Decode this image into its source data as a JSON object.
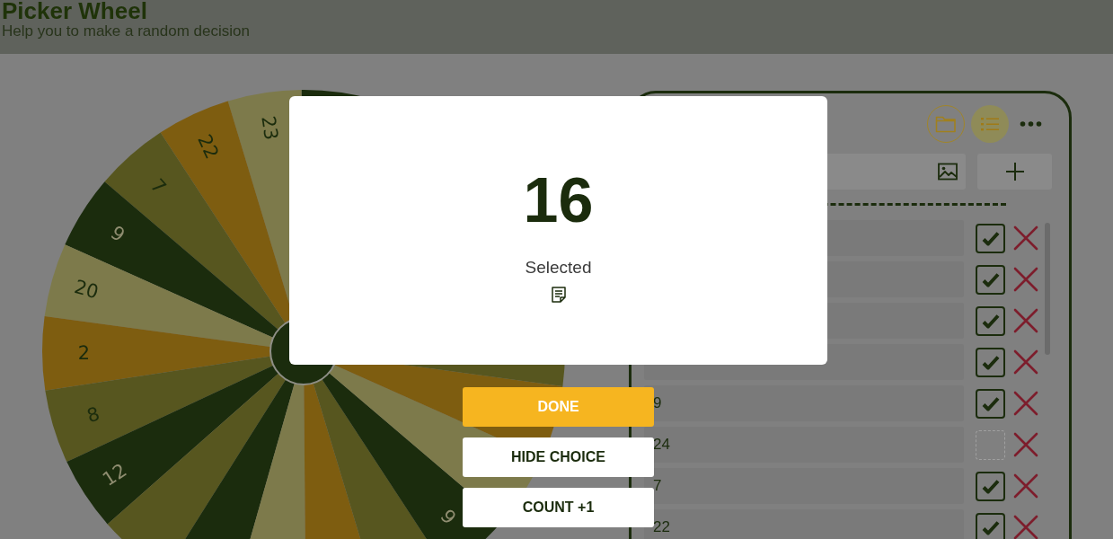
{
  "header": {
    "title": "Picker Wheel",
    "subtitle": "Help you to make a random decision"
  },
  "wheel": {
    "segments": [
      {
        "color": "#1b2c0d"
      },
      {
        "label": "23",
        "color": "#7d7a4b"
      },
      {
        "label": "22",
        "color": "#7e5d10"
      },
      {
        "label": "7",
        "color": "#57561f"
      },
      {
        "label": "9",
        "color": "#1b2c0d"
      },
      {
        "label": "20",
        "color": "#7d7a4b"
      },
      {
        "label": "2",
        "color": "#7e5d10"
      },
      {
        "label": "8",
        "color": "#57561f"
      },
      {
        "label": "12",
        "color": "#1b2c0d"
      },
      {
        "color": "#57561f"
      },
      {
        "color": "#1b2c0d"
      },
      {
        "color": "#7d7a4b"
      },
      {
        "color": "#7e5d10"
      },
      {
        "color": "#57561f"
      },
      {
        "label": "6",
        "color": "#1b2c0d"
      },
      {
        "color": "#7d7a4b"
      },
      {
        "color": "#7e5d10"
      },
      {
        "color": "#57561f"
      }
    ]
  },
  "panel": {
    "view_toggles": [
      {
        "kind": "folder",
        "selected": false
      },
      {
        "kind": "list",
        "selected": true
      }
    ],
    "entries": [
      {
        "checked": true
      },
      {
        "checked": true
      },
      {
        "checked": true
      },
      {
        "checked": true
      },
      {
        "value": "9",
        "checked": true
      },
      {
        "value": "24",
        "checked": false
      },
      {
        "value": "7",
        "checked": true
      },
      {
        "value": "22",
        "checked": true
      }
    ]
  },
  "result_dialog": {
    "value": "16",
    "caption": "Selected"
  },
  "buttons": [
    {
      "label": "DONE",
      "kind": "primary"
    },
    {
      "label": "HIDE CHOICE",
      "kind": "secondary"
    },
    {
      "label": "COUNT +1",
      "kind": "secondary"
    }
  ]
}
